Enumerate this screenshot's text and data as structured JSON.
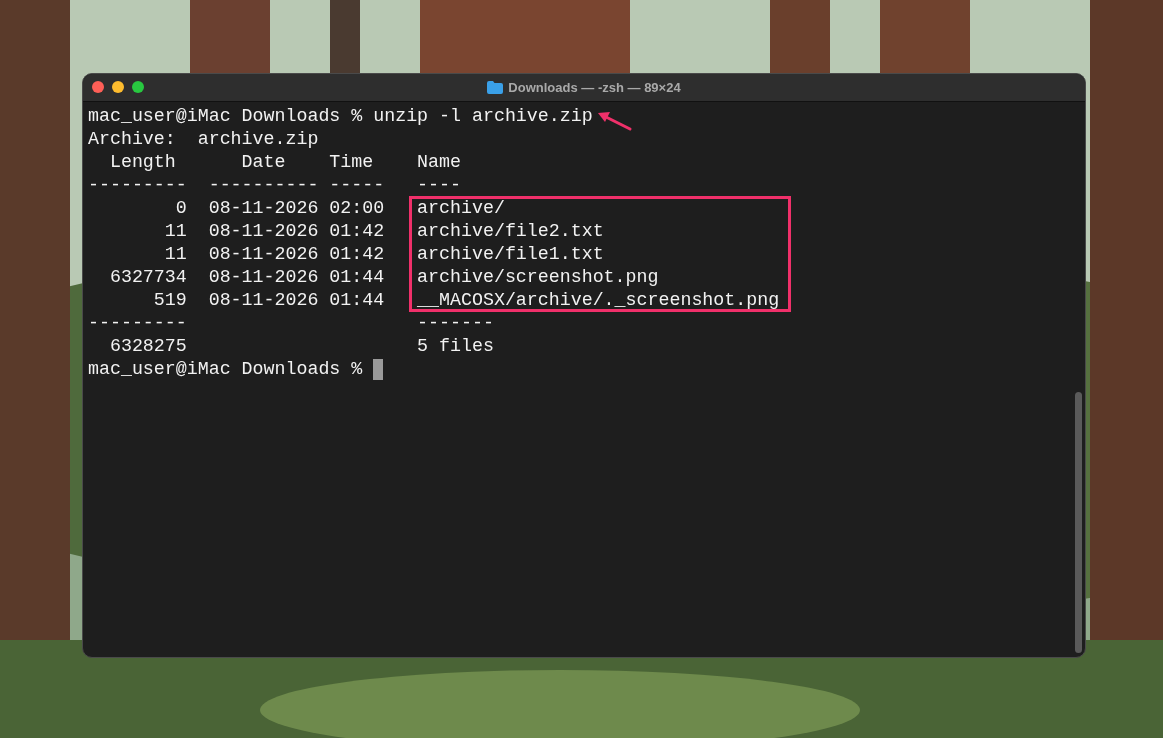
{
  "window": {
    "title": "Downloads — -zsh — 89×24"
  },
  "terminal": {
    "lines": [
      "mac_user@iMac Downloads % unzip -l archive.zip",
      "Archive:  archive.zip",
      "  Length      Date    Time    Name",
      "---------  ---------- -----   ----",
      "        0  08-11-2026 02:00   archive/",
      "       11  08-11-2026 01:42   archive/file2.txt",
      "       11  08-11-2026 01:42   archive/file1.txt",
      "  6327734  08-11-2026 01:44   archive/screenshot.png",
      "      519  08-11-2026 01:44   __MACOSX/archive/._screenshot.png",
      "---------                     -------",
      "  6328275                     5 files"
    ],
    "prompt": "mac_user@iMac Downloads %",
    "cursor": true
  },
  "annotations": {
    "arrow": true,
    "highlight_box": true
  }
}
